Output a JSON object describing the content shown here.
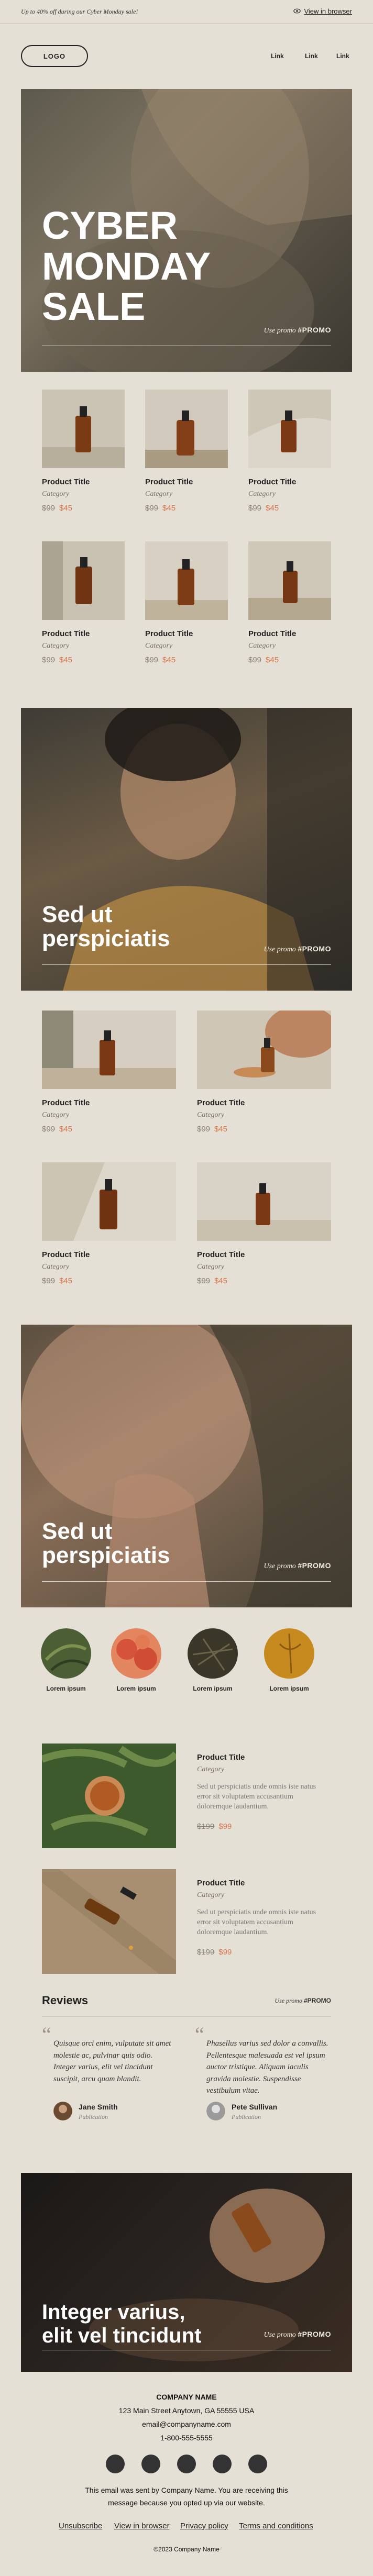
{
  "topbar": {
    "promo": "Up to 40% off  during our Cyber Monday sale!",
    "view_browser": "View in browser"
  },
  "header": {
    "logo": "LOGO",
    "links": [
      "Link",
      "Link",
      "Link"
    ]
  },
  "hero1": {
    "title_lines": [
      "CYBER",
      "MONDAY",
      "SALE"
    ],
    "promo_prefix": "Use promo",
    "promo_code": "#PROMO"
  },
  "products1": [
    {
      "title": "Product Title",
      "category": "Category",
      "old_price": "$99",
      "price": "$45"
    },
    {
      "title": "Product Title",
      "category": "Category",
      "old_price": "$99",
      "price": "$45"
    },
    {
      "title": "Product Title",
      "category": "Category",
      "old_price": "$99",
      "price": "$45"
    },
    {
      "title": "Product Title",
      "category": "Category",
      "old_price": "$99",
      "price": "$45"
    },
    {
      "title": "Product Title",
      "category": "Category",
      "old_price": "$99",
      "price": "$45"
    },
    {
      "title": "Product Title",
      "category": "Category",
      "old_price": "$99",
      "price": "$45"
    }
  ],
  "hero2": {
    "title_lines": [
      "Sed ut",
      "perspiciatis"
    ],
    "promo_prefix": "Use promo",
    "promo_code": "#PROMO"
  },
  "products2": [
    {
      "title": "Product Title",
      "category": "Category",
      "old_price": "$99",
      "price": "$45"
    },
    {
      "title": "Product Title",
      "category": "Category",
      "old_price": "$99",
      "price": "$45"
    },
    {
      "title": "Product Title",
      "category": "Category",
      "old_price": "$99",
      "price": "$45"
    },
    {
      "title": "Product Title",
      "category": "Category",
      "old_price": "$99",
      "price": "$45"
    }
  ],
  "hero3": {
    "title_lines": [
      "Sed ut",
      "perspiciatis"
    ],
    "promo_prefix": "Use promo",
    "promo_code": "#PROMO"
  },
  "ingredients": [
    "Lorem ipsum",
    "Lorem ipsum",
    "Lorem ipsum",
    "Lorem ipsum"
  ],
  "featured": [
    {
      "title": "Product Title",
      "category": "Category",
      "desc": "Sed ut perspiciatis unde omnis iste natus error sit voluptatem accusantium doloremque laudantium.",
      "old_price": "$199",
      "price": "$99"
    },
    {
      "title": "Product Title",
      "category": "Category",
      "desc": "Sed ut perspiciatis unde omnis iste natus error sit voluptatem accusantium doloremque laudantium.",
      "old_price": "$199",
      "price": "$99"
    }
  ],
  "reviews": {
    "heading": "Reviews",
    "promo_prefix": "Use promo",
    "promo_code": "#PROMO",
    "items": [
      {
        "text": "Quisque orci enim, vulputate sit amet molestie ac, pulvinar quis odio. Integer varius, elit vel tincidunt suscipit, arcu quam blandit.",
        "name": "Jane Smith",
        "role": "Publication"
      },
      {
        "text": "Phasellus varius sed dolor a convallis. Pellentesque malesuada est vel ipsum auctor tristique. Aliquam iaculis gravida molestie. Suspendisse vestibulum vitae.",
        "name": "Pete Sullivan",
        "role": "Publication"
      }
    ]
  },
  "hero4": {
    "title_lines": [
      "Integer varius,",
      "elit vel tincidunt"
    ],
    "promo_prefix": "Use promo",
    "promo_code": "#PROMO"
  },
  "footer": {
    "company": "COMPANY NAME",
    "address": "123 Main Street Anytown, GA 55555 USA",
    "email": "email@companyname.com",
    "phone": "1-800-555-5555",
    "notice_line1": "This email was sent by Company Name. You are receiving this",
    "notice_line2": "message because you opted up via our website.",
    "links": [
      "Unsubscribe",
      "View in browser",
      "Privacy policy",
      "Terms and conditions"
    ],
    "copyright": "©2023 Company Name"
  },
  "colors": {
    "background": "#e5e0d5",
    "accent": "#d8744a",
    "dark": "#222222"
  }
}
